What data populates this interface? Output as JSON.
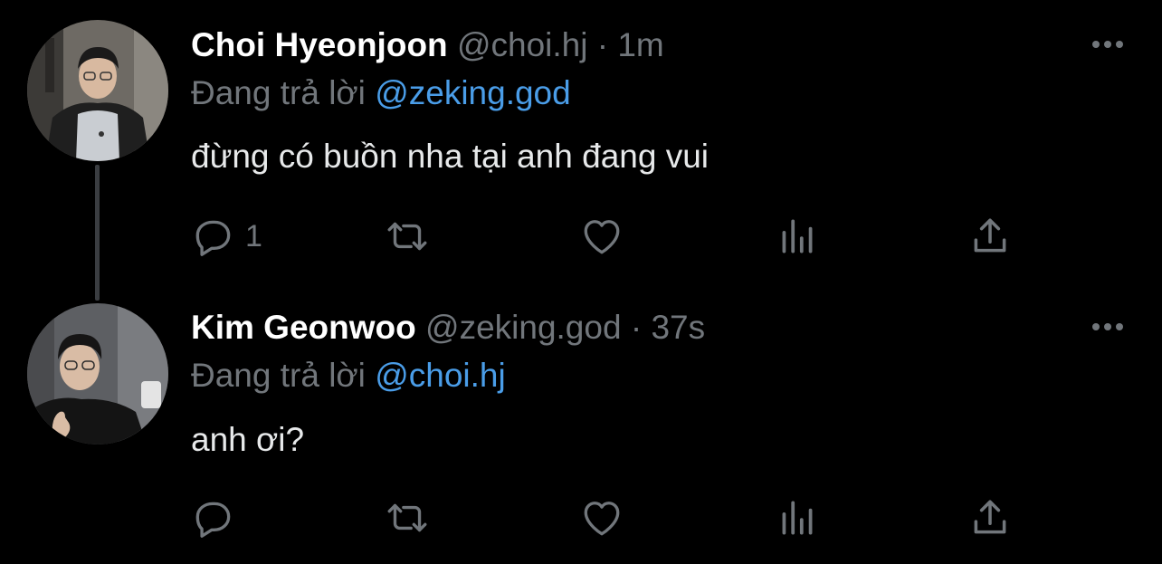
{
  "tweets": [
    {
      "author": {
        "display_name": "Choi Hyeonjoon",
        "handle": "@choi.hj",
        "avatar": "person-photo-avatar"
      },
      "separator": "·",
      "time": "1m",
      "reply_prefix": "Đang trả lời",
      "reply_to": "@zeking.god",
      "text": "đừng có buồn nha tại anh đang vui",
      "reply_count": "1"
    },
    {
      "author": {
        "display_name": "Kim Geonwoo",
        "handle": "@zeking.god",
        "avatar": "person-photo-avatar"
      },
      "separator": "·",
      "time": "37s",
      "reply_prefix": "Đang trả lời",
      "reply_to": "@choi.hj",
      "text": "anh ơi?",
      "reply_count": ""
    }
  ],
  "icons": {
    "more": "more-horizontal-icon",
    "reply": "reply-bubble-icon",
    "retweet": "retweet-icon",
    "like": "heart-icon",
    "views": "views-bar-chart-icon",
    "share": "share-upload-icon"
  },
  "colors": {
    "background": "#000000",
    "primary_text": "#e7e9ea",
    "secondary_text": "#71767b",
    "mention": "#4a9de8",
    "thread_line": "#3a3d41"
  }
}
